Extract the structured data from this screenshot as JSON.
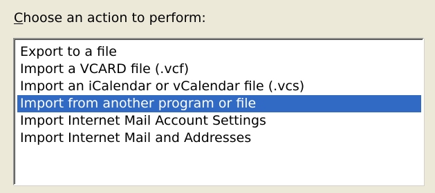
{
  "prompt": {
    "mnemonic": "C",
    "rest": "hoose an action to perform:"
  },
  "actions": {
    "items": [
      {
        "label": "Export to a file",
        "selected": false
      },
      {
        "label": "Import a VCARD file (.vcf)",
        "selected": false
      },
      {
        "label": "Import an iCalendar or vCalendar file (.vcs)",
        "selected": false
      },
      {
        "label": "Import from another program or file",
        "selected": true
      },
      {
        "label": "Import Internet Mail Account Settings",
        "selected": false
      },
      {
        "label": "Import Internet Mail and Addresses",
        "selected": false
      }
    ]
  },
  "colors": {
    "dialog_background": "#ece9d8",
    "selection_background": "#316ac5",
    "selection_text": "#ffffff"
  }
}
